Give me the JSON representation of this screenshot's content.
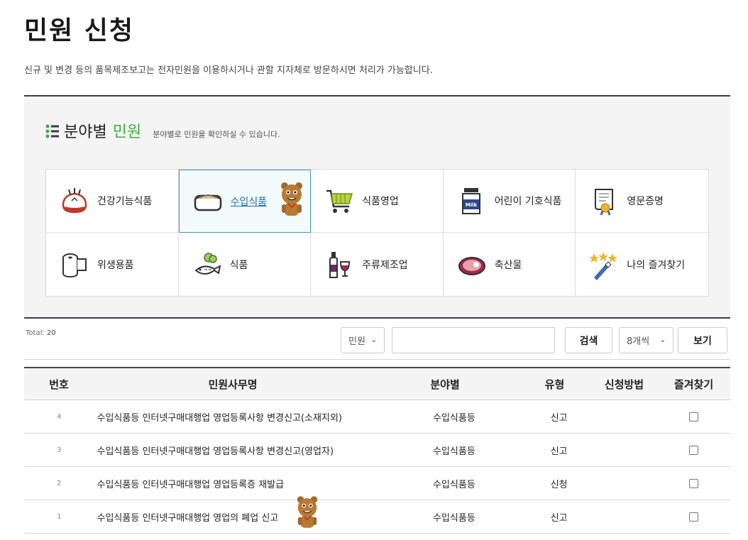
{
  "page": {
    "title": "민원 신청",
    "description": "신규 및 변경 등의 품목제조보고는 전자민원을 이용하시거나 관할 지자체로 방문하시면 처리가 가능합니다."
  },
  "panel": {
    "title_a": "분야별",
    "title_b": "민원",
    "subtitle": "분야별로 민원을 확인하실 수 있습니다."
  },
  "categories": [
    {
      "label": "건강기능식품",
      "icon": "health-food-icon"
    },
    {
      "label": "수입식품",
      "icon": "bread-icon",
      "active": true
    },
    {
      "label": "식품영업",
      "icon": "cart-icon"
    },
    {
      "label": "어린이 기호식품",
      "icon": "milk-icon"
    },
    {
      "label": "영문증명",
      "icon": "certificate-icon"
    },
    {
      "label": "위생용품",
      "icon": "toilet-paper-icon"
    },
    {
      "label": "식품",
      "icon": "food-icon"
    },
    {
      "label": "주류제조업",
      "icon": "liquor-icon"
    },
    {
      "label": "축산물",
      "icon": "meat-icon"
    },
    {
      "label": "나의 즐겨찾기",
      "icon": "favorites-icon"
    }
  ],
  "search": {
    "total_label": "Total:",
    "total_count": "20",
    "field_select": "민원",
    "input_value": "",
    "search_button": "검색",
    "page_size_select": "8개씩",
    "view_button": "보기"
  },
  "table": {
    "headers": {
      "no": "번호",
      "name": "민원사무명",
      "category": "분야별",
      "type": "유형",
      "method": "신청방법",
      "fav": "즐겨찾기"
    },
    "rows": [
      {
        "no": "4",
        "name": "수입식품등 인터넷구매대행업 영업등록사항 변경신고(소재지외)",
        "category": "수입식품등",
        "type": "신고",
        "method": ""
      },
      {
        "no": "3",
        "name": "수입식품등 인터넷구매대행업 영업등록사항 변경신고(영업자)",
        "category": "수입식품등",
        "type": "신고",
        "method": ""
      },
      {
        "no": "2",
        "name": "수입식품등 인터넷구매대행업 영업등록증 재발급",
        "category": "수입식품등",
        "type": "신청",
        "method": ""
      },
      {
        "no": "1",
        "name": "수입식품등 인터넷구매대행업 영업의 폐업 신고",
        "category": "수입식품등",
        "type": "신고",
        "method": ""
      }
    ]
  },
  "colors": {
    "accent_green": "#3dae3d",
    "active_border": "#3d9ab0",
    "header_border": "#3a3a4a"
  }
}
